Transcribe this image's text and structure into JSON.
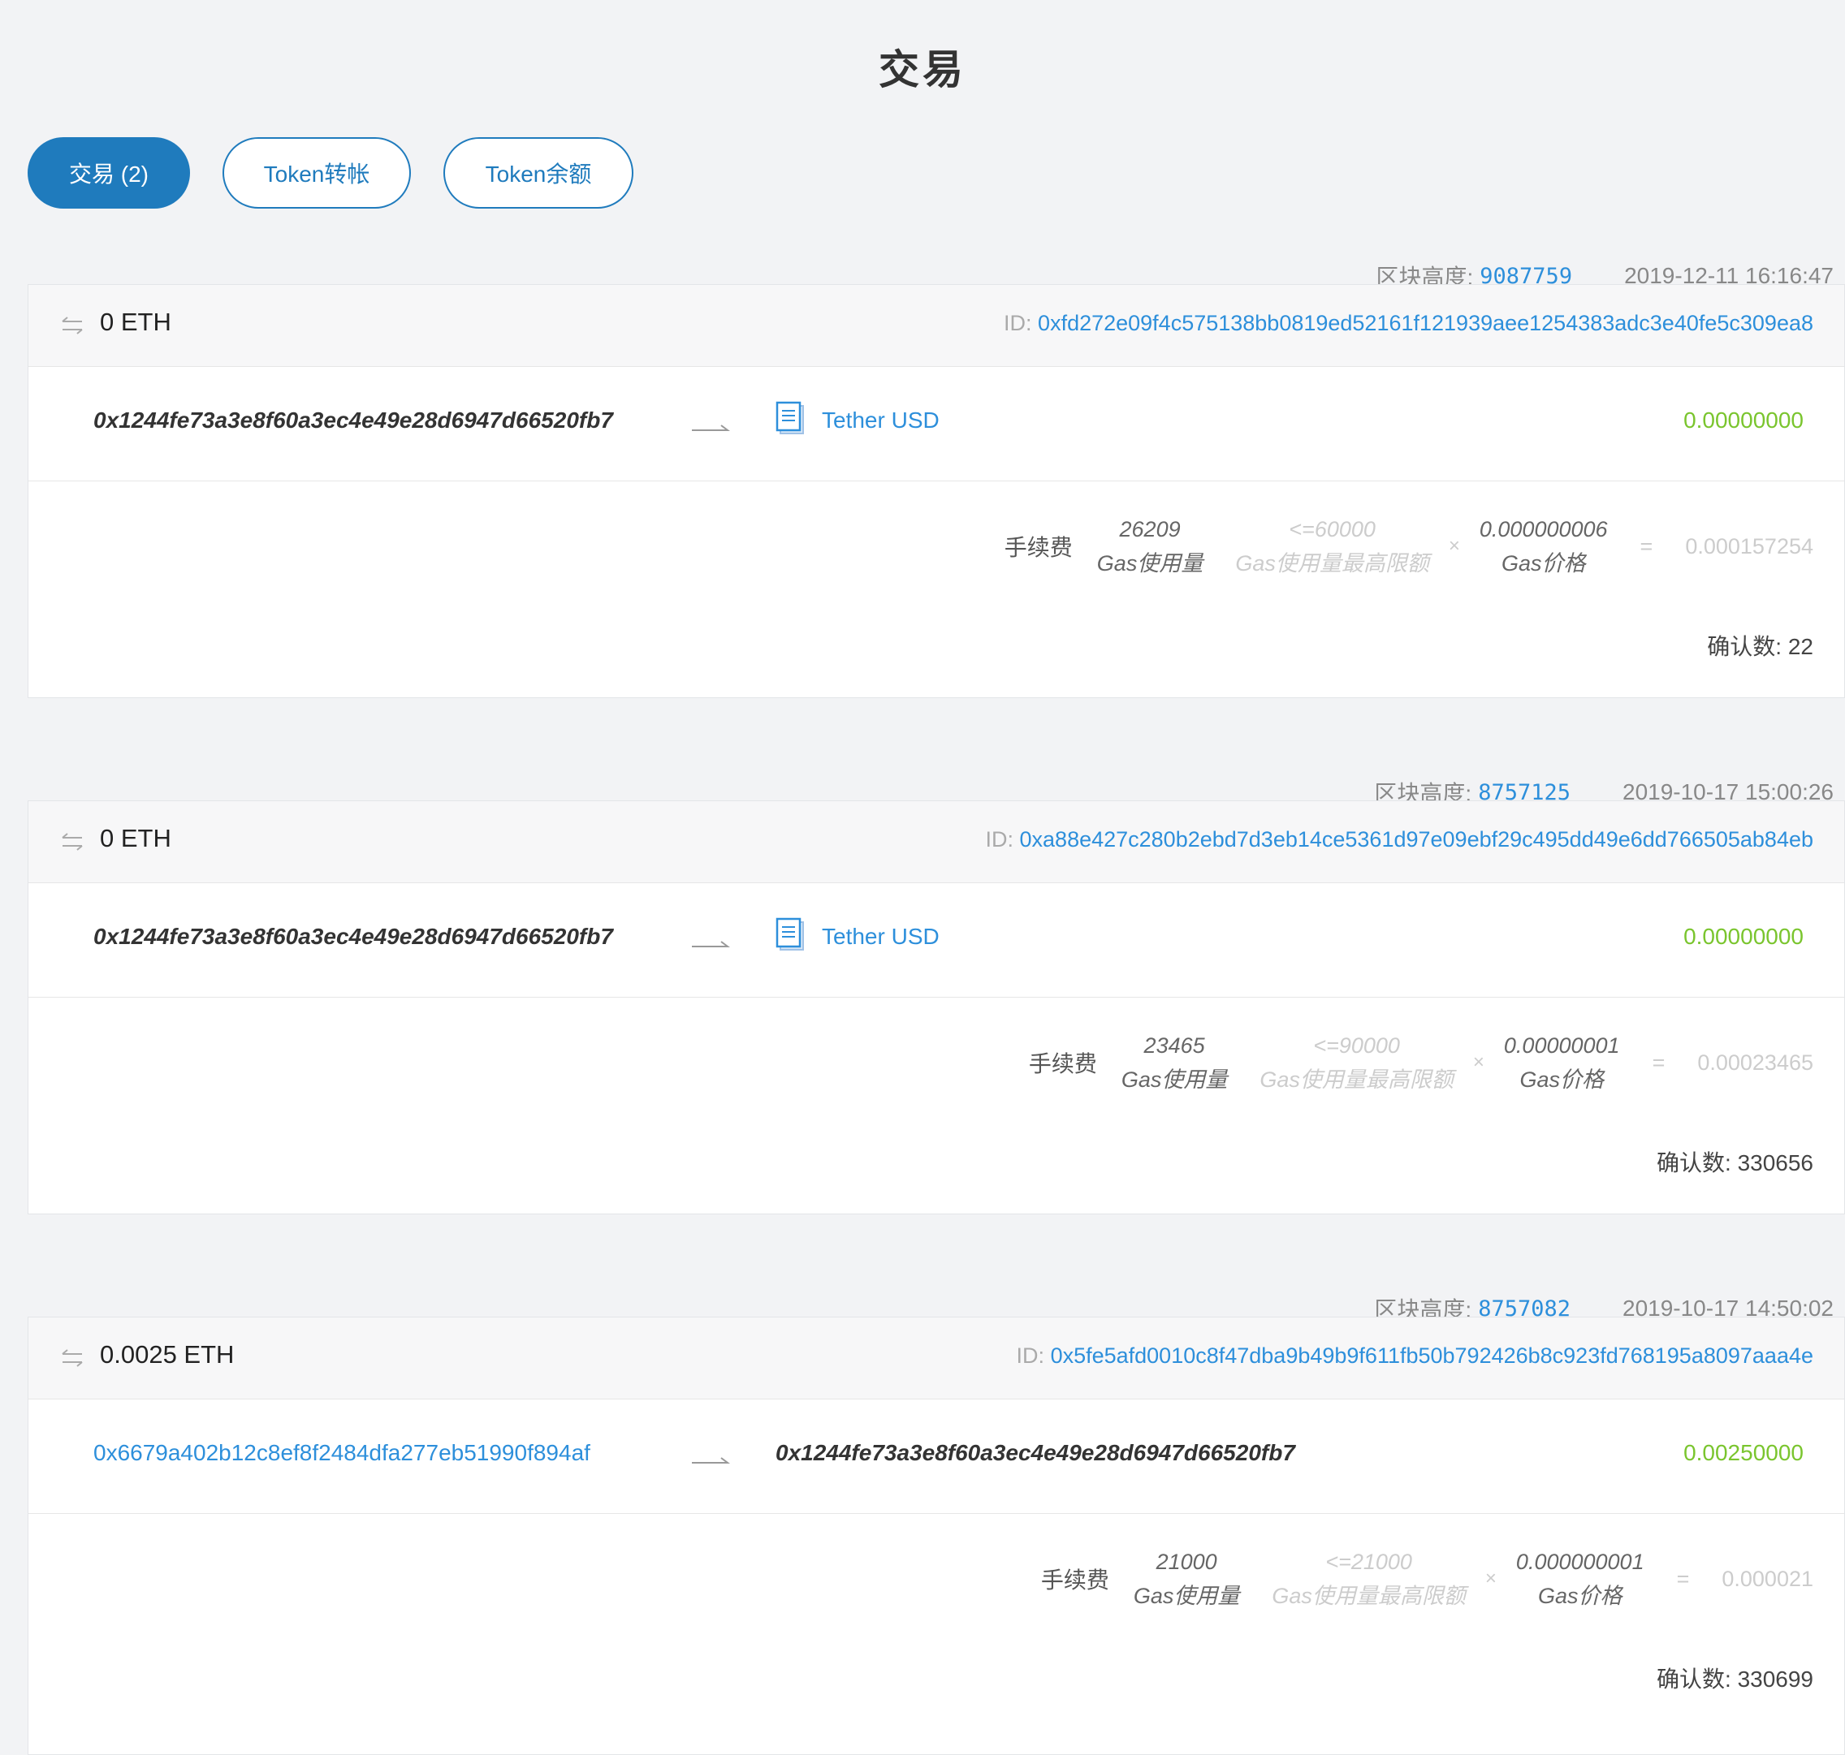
{
  "page": {
    "title": "交易"
  },
  "tabs": [
    {
      "label": "交易 (2)"
    },
    {
      "label": "Token转帐"
    },
    {
      "label": "Token余额"
    }
  ],
  "labels": {
    "block_height": "区块高度:",
    "id": "ID:",
    "fee": "手续费",
    "gas_used": "Gas使用量",
    "gas_limit": "Gas使用量最高限额",
    "gas_price": "Gas价格",
    "times": "×",
    "equals": "=",
    "confirmations": "确认数:"
  },
  "transactions": [
    {
      "block": "9087759",
      "time": "2019-12-11 16:16:47",
      "amount": "0 ETH",
      "id": "0xfd272e09f4c575138bb0819ed52161f121939aee1254383adc3e40fe5c309ea8",
      "from": "0x1244fe73a3e8f60a3ec4e49e28d6947d66520fb7",
      "to": "Tether USD",
      "value": "0.00000000",
      "gas_used": "26209",
      "gas_limit": "<=60000",
      "gas_price": "0.000000006",
      "fee_total": "0.000157254",
      "confirmations": "22"
    },
    {
      "block": "8757125",
      "time": "2019-10-17 15:00:26",
      "amount": "0 ETH",
      "id": "0xa88e427c280b2ebd7d3eb14ce5361d97e09ebf29c495dd49e6dd766505ab84eb",
      "from": "0x1244fe73a3e8f60a3ec4e49e28d6947d66520fb7",
      "to": "Tether USD",
      "value": "0.00000000",
      "gas_used": "23465",
      "gas_limit": "<=90000",
      "gas_price": "0.00000001",
      "fee_total": "0.00023465",
      "confirmations": "330656"
    },
    {
      "block": "8757082",
      "time": "2019-10-17 14:50:02",
      "amount": "0.0025 ETH",
      "id": "0x5fe5afd0010c8f47dba9b49b9f611fb50b792426b8c923fd768195a8097aaa4e",
      "from": "0x6679a402b12c8ef8f2484dfa277eb51990f894af",
      "to": "0x1244fe73a3e8f60a3ec4e49e28d6947d66520fb7",
      "value": "0.00250000",
      "gas_used": "21000",
      "gas_limit": "<=21000",
      "gas_price": "0.000000001",
      "fee_total": "0.000021",
      "confirmations": "330699"
    }
  ],
  "colors": {
    "accent": "#1f7bbd",
    "link": "#2d8fdb",
    "value": "#7ac52e"
  }
}
